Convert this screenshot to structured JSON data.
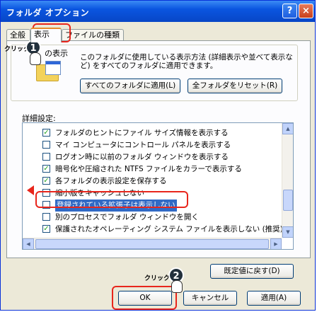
{
  "window": {
    "title": "フォルダ オプション",
    "help_button": "?",
    "close_button": "×"
  },
  "tabs": [
    {
      "label": "全般"
    },
    {
      "label": "表示"
    },
    {
      "label": "ファイルの種類"
    }
  ],
  "folder_views": {
    "heading": "の表示",
    "description": "このフォルダに使用している表示方法 (詳細表示や並べて表示など) をすべてのフォルダに適用できます。",
    "apply_all_button": "すべてのフォルダに適用(L)",
    "reset_all_button": "全フォルダをリセット(R)"
  },
  "advanced": {
    "label": "詳細設定:",
    "items": [
      {
        "label": "フォルダのヒントにファイル サイズ情報を表示する",
        "checked": "✓"
      },
      {
        "label": "マイ コンピュータにコントロール パネルを表示する",
        "checked": ""
      },
      {
        "label": "ログオン時に以前のフォルダ ウィンドウを表示する",
        "checked": ""
      },
      {
        "label": "暗号化や圧縮された NTFS ファイルをカラーで表示する",
        "checked": "✓"
      },
      {
        "label": "各フォルダの表示設定を保存する",
        "checked": "✓"
      },
      {
        "label": "縮小版をキャッシュしない",
        "checked": ""
      },
      {
        "label": "登録されている拡張子は表示しない",
        "checked": ""
      },
      {
        "label": "別のプロセスでフォルダ ウィンドウを開く",
        "checked": ""
      },
      {
        "label": "保護されたオペレーティング システム ファイルを表示しない (推奨)",
        "checked": "✓"
      }
    ]
  },
  "restore_defaults_button": "既定値に戻す(D)",
  "footer": {
    "ok": "OK",
    "cancel": "キャンセル",
    "apply": "適用(A)"
  },
  "annotations": {
    "click_label_1": "クリック",
    "number_1": "1",
    "click_label_2": "クリック",
    "number_2": "2"
  },
  "colors": {
    "title_bar": "#0a55e0",
    "selection": "#316ac5",
    "highlight_outline": "#e8261c"
  }
}
